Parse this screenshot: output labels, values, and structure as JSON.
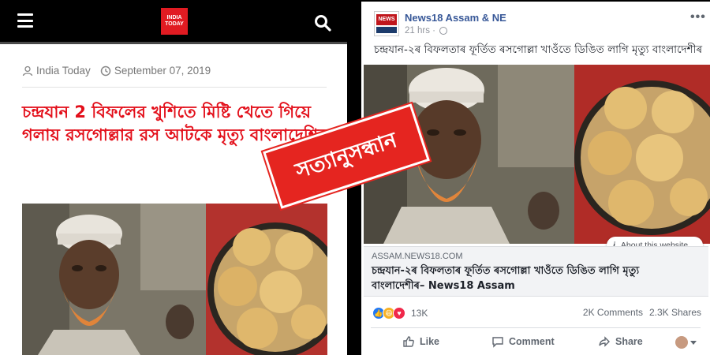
{
  "left_article": {
    "header": {
      "logo_text": "INDIA TODAY",
      "menu_icon": "hamburger-menu-icon",
      "search_icon": "search-icon",
      "logo_color": "#e11b22"
    },
    "meta": {
      "author": "India Today",
      "date": "September 07, 2019"
    },
    "headline": "চন্দ্রযান 2 বিফলের খুশিতে মিষ্টি খেতে গিয়ে গলায় রসগোল্লার রস আটকে মৃত্যু বাংলাদেশির",
    "headline_color": "#e30f1a"
  },
  "facebook_post": {
    "page_name": "News18 Assam & NE",
    "avatar_text": "NEWS 18",
    "timestamp": "21 hrs ·",
    "caption": "চন্দ্ৰযান-২ৰ বিফলতাৰ ফূৰ্তিত ৰসগোল্লা খাওঁতে ডিঙিত লাগি মৃত্যু বাংলাদেশীৰ",
    "about_website": "About this website",
    "link_domain": "ASSAM.NEWS18.COM",
    "link_title": "চন্দ্ৰযান-২ৰ বিফলতাৰ ফূৰ্তিত ৰসগোল্লা খাওঁতে ডিঙিত লাগি মৃত্যু বাংলাদেশীৰ– News18 Assam",
    "reaction_count": "13K",
    "comments": "2K Comments",
    "shares": "2.3K Shares",
    "actions": {
      "like": "Like",
      "comment": "Comment",
      "share": "Share"
    },
    "link_color": "#385898"
  },
  "stamp": {
    "text": "সত্যানুসন্ধান",
    "color": "#e52520"
  }
}
